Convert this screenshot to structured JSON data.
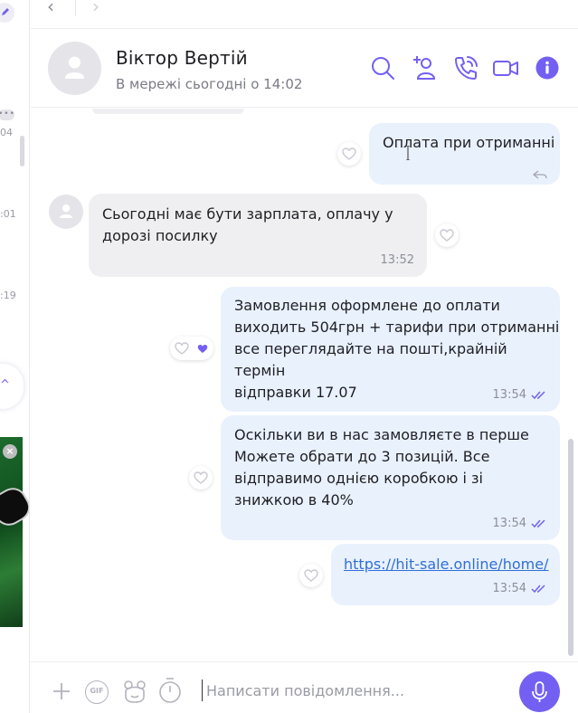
{
  "sidebar": {
    "dots": "•••",
    "times": [
      "04",
      ":01",
      ":19"
    ]
  },
  "header": {
    "name": "Віктор Вертій",
    "status": "В мережі сьогодні о 14:02"
  },
  "messages": [
    {
      "dir": "out",
      "text": "Оплата при отриманні",
      "time": ""
    },
    {
      "dir": "in",
      "text": "Сьогодні має бути зарплата, оплачу у\nдорозі посилку",
      "time": "13:52"
    },
    {
      "dir": "out",
      "text": "Замовлення оформлене до оплати\nвиходить 504грн + тарифи при отриманні\nвсе переглядайте на пошті,крайній термін\nвідправки 17.07",
      "time": "13:54"
    },
    {
      "dir": "out",
      "text": "Оскільки ви в нас замовляєте в перше\nМожете обрати до 3 позицій. Все\nвідправимо однією коробкою і зі\nзнижкою в 40%",
      "time": "13:54"
    },
    {
      "dir": "out",
      "text": "https://hit-sale.online/home/",
      "time": "13:54",
      "is_link": true
    }
  ],
  "composer": {
    "placeholder": "Написати повідомлення...",
    "gif_label": "GIF"
  },
  "colors": {
    "accent": "#7360f2",
    "outgoing_bubble": "#e9f1fd",
    "incoming_bubble": "#efeff2",
    "link": "#2f6fd6"
  },
  "icons": [
    "back-arrow-icon",
    "forward-arrow-icon",
    "search-icon",
    "add-participant-icon",
    "call-icon",
    "video-call-icon",
    "info-icon",
    "heart-icon",
    "plus-icon",
    "gif-icon",
    "sticker-icon",
    "timer-icon",
    "microphone-icon",
    "double-check-icon",
    "reply-icon"
  ]
}
